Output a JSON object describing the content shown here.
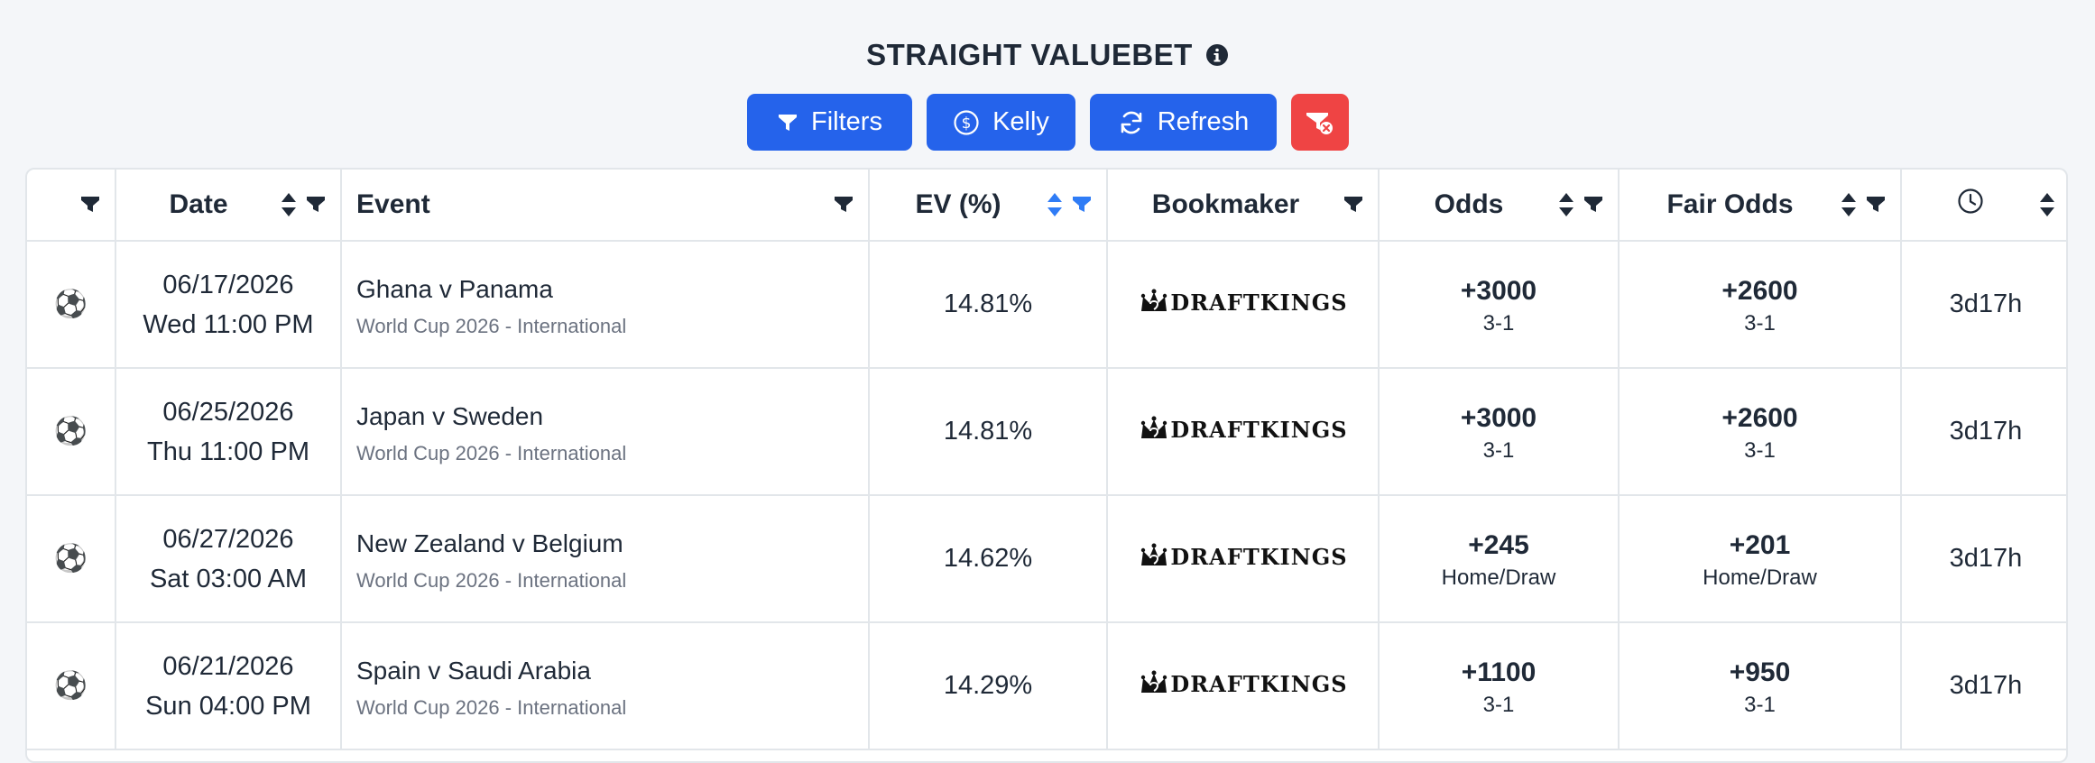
{
  "header": {
    "title": "STRAIGHT VALUEBET",
    "info_icon": "info-circle-icon"
  },
  "toolbar": {
    "filters_label": "Filters",
    "kelly_label": "Kelly",
    "refresh_label": "Refresh",
    "accent_color": "#2563eb",
    "danger_color": "#ef4444"
  },
  "table": {
    "columns": [
      "",
      "Date",
      "Event",
      "EV (%)",
      "Bookmaker",
      "Odds",
      "Fair Odds",
      ""
    ],
    "active_sort_color": "#2f7cf6",
    "rows": [
      {
        "sport": "⚽",
        "date": "06/17/2026",
        "time": "Wed 11:00 PM",
        "event": "Ghana v Panama",
        "league": "World Cup 2026 - International",
        "ev": "14.81%",
        "bookmaker": "DRAFTKINGS",
        "odds": "+3000",
        "odds_market": "3-1",
        "fair_odds": "+2600",
        "fair_market": "3-1",
        "countdown": "3d17h"
      },
      {
        "sport": "⚽",
        "date": "06/25/2026",
        "time": "Thu 11:00 PM",
        "event": "Japan v Sweden",
        "league": "World Cup 2026 - International",
        "ev": "14.81%",
        "bookmaker": "DRAFTKINGS",
        "odds": "+3000",
        "odds_market": "3-1",
        "fair_odds": "+2600",
        "fair_market": "3-1",
        "countdown": "3d17h"
      },
      {
        "sport": "⚽",
        "date": "06/27/2026",
        "time": "Sat 03:00 AM",
        "event": "New Zealand v Belgium",
        "league": "World Cup 2026 - International",
        "ev": "14.62%",
        "bookmaker": "DRAFTKINGS",
        "odds": "+245",
        "odds_market": "Home/Draw",
        "fair_odds": "+201",
        "fair_market": "Home/Draw",
        "countdown": "3d17h"
      },
      {
        "sport": "⚽",
        "date": "06/21/2026",
        "time": "Sun 04:00 PM",
        "event": "Spain v Saudi Arabia",
        "league": "World Cup 2026 - International",
        "ev": "14.29%",
        "bookmaker": "DRAFTKINGS",
        "odds": "+1100",
        "odds_market": "3-1",
        "fair_odds": "+950",
        "fair_market": "3-1",
        "countdown": "3d17h"
      }
    ]
  }
}
